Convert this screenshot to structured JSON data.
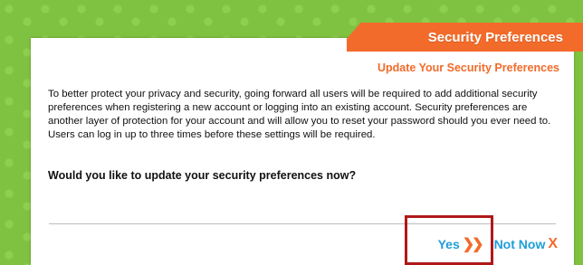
{
  "header": {
    "title": "Security Preferences"
  },
  "dialog": {
    "subtitle": "Update Your Security Preferences",
    "message": "To better protect your privacy and security, going forward all users will be required to add additional security preferences when registering a new account or logging into an existing account. Security preferences are another layer of protection for your account and will allow you to reset your password should you ever need to. Users can log in up to three times before these settings will be required.",
    "question": "Would you like to update your security preferences now?"
  },
  "actions": {
    "yes_label": "Yes",
    "yes_icon": "double-chevron-right-icon",
    "no_label": "Not Now",
    "no_icon": "x-icon"
  },
  "colors": {
    "accent": "#f26b2a",
    "link": "#1e9ed8",
    "background": "#7fc241",
    "highlight": "#b01818"
  }
}
